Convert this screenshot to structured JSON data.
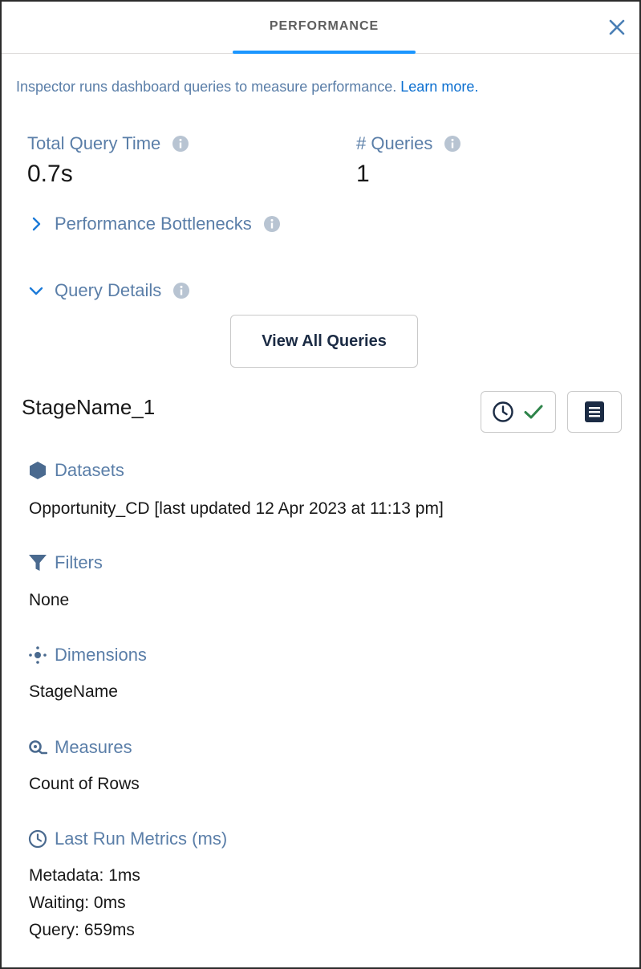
{
  "header": {
    "tab_label": "PERFORMANCE",
    "close_icon": "close-icon"
  },
  "intro": {
    "text": "Inspector runs dashboard queries to measure performance.",
    "link": "Learn more."
  },
  "stats": {
    "total_query_time": {
      "label": "Total Query Time",
      "value": "0.7s"
    },
    "query_count": {
      "label": "# Queries",
      "value": "1"
    }
  },
  "sections": {
    "bottlenecks": {
      "label": "Performance Bottlenecks",
      "expanded": false
    },
    "query_details": {
      "label": "Query Details",
      "expanded": true
    }
  },
  "view_all_button": "View All Queries",
  "query": {
    "name": "StageName_1",
    "datasets": {
      "label": "Datasets",
      "value": "Opportunity_CD [last updated 12 Apr 2023 at 11:13 pm]"
    },
    "filters": {
      "label": "Filters",
      "value": "None"
    },
    "dimensions": {
      "label": "Dimensions",
      "value": "StageName"
    },
    "measures": {
      "label": "Measures",
      "value": "Count of Rows"
    },
    "last_run": {
      "label": "Last Run Metrics (ms)",
      "metrics": [
        "Metadata: 1ms",
        "Waiting: 0ms",
        "Query: 659ms"
      ]
    }
  },
  "colors": {
    "accent": "#1b96ff",
    "label": "#5a7ea8",
    "link": "#0b6fd0",
    "success": "#2e844a",
    "icon": "#4a6a8f"
  }
}
